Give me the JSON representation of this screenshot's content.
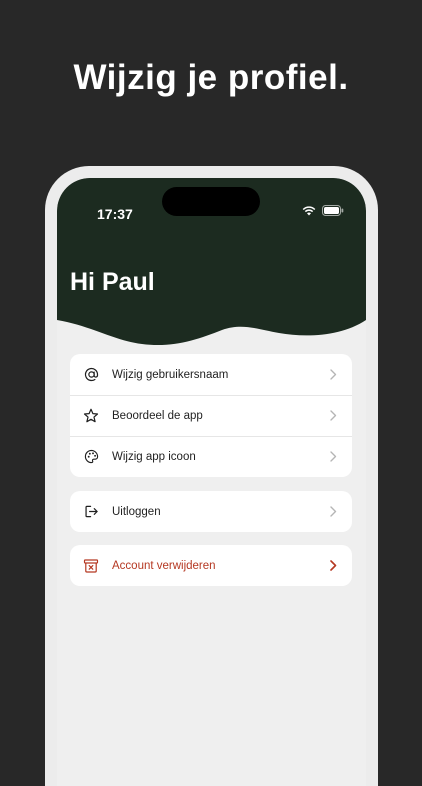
{
  "headline": "Wijzig je profiel.",
  "status_bar": {
    "time": "17:37"
  },
  "header": {
    "greeting": "Hi Paul",
    "color": "#1c2b20"
  },
  "menu_groups": [
    {
      "items": [
        {
          "label": "Wijzig gebruikersnaam",
          "icon": "at-icon"
        },
        {
          "label": "Beoordeel de app",
          "icon": "star-icon"
        },
        {
          "label": "Wijzig app icoon",
          "icon": "palette-icon"
        }
      ]
    },
    {
      "items": [
        {
          "label": "Uitloggen",
          "icon": "logout-icon"
        }
      ]
    },
    {
      "items": [
        {
          "label": "Account verwijderen",
          "icon": "delete-box-icon",
          "color": "#b53822"
        }
      ]
    }
  ]
}
